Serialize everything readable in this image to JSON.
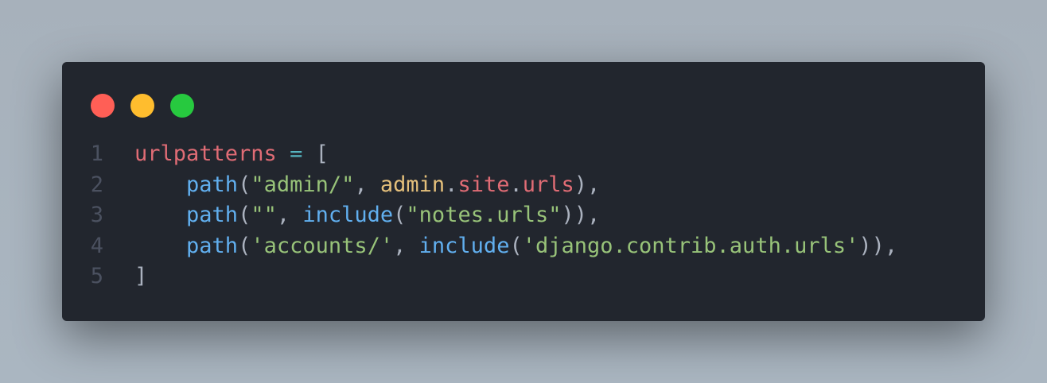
{
  "window": {
    "controls": [
      {
        "name": "close",
        "color": "#ff5f56"
      },
      {
        "name": "minimize",
        "color": "#ffbd2e"
      },
      {
        "name": "maximize",
        "color": "#27c93f"
      }
    ]
  },
  "code": {
    "language": "python",
    "lines": [
      {
        "number": "1",
        "tokens": [
          [
            "urlpatterns",
            "red"
          ],
          [
            " ",
            "fg"
          ],
          [
            "=",
            "cyan"
          ],
          [
            " [",
            "fg"
          ]
        ]
      },
      {
        "number": "2",
        "tokens": [
          [
            "    ",
            "fg"
          ],
          [
            "path",
            "blue"
          ],
          [
            "(",
            "fg"
          ],
          [
            "\"admin/\"",
            "green"
          ],
          [
            ", ",
            "fg"
          ],
          [
            "admin",
            "yellow"
          ],
          [
            ".",
            "fg"
          ],
          [
            "site",
            "red"
          ],
          [
            ".",
            "fg"
          ],
          [
            "urls",
            "red"
          ],
          [
            "),",
            "fg"
          ]
        ]
      },
      {
        "number": "3",
        "tokens": [
          [
            "    ",
            "fg"
          ],
          [
            "path",
            "blue"
          ],
          [
            "(",
            "fg"
          ],
          [
            "\"\"",
            "green"
          ],
          [
            ", ",
            "fg"
          ],
          [
            "include",
            "blue"
          ],
          [
            "(",
            "fg"
          ],
          [
            "\"notes.urls\"",
            "green"
          ],
          [
            ")),",
            "fg"
          ]
        ]
      },
      {
        "number": "4",
        "tokens": [
          [
            "    ",
            "fg"
          ],
          [
            "path",
            "blue"
          ],
          [
            "(",
            "fg"
          ],
          [
            "'accounts/'",
            "green"
          ],
          [
            ", ",
            "fg"
          ],
          [
            "include",
            "blue"
          ],
          [
            "(",
            "fg"
          ],
          [
            "'django.contrib.auth.urls'",
            "green"
          ],
          [
            ")),",
            "fg"
          ]
        ]
      },
      {
        "number": "5",
        "tokens": [
          [
            "]",
            "fg"
          ]
        ]
      }
    ]
  }
}
